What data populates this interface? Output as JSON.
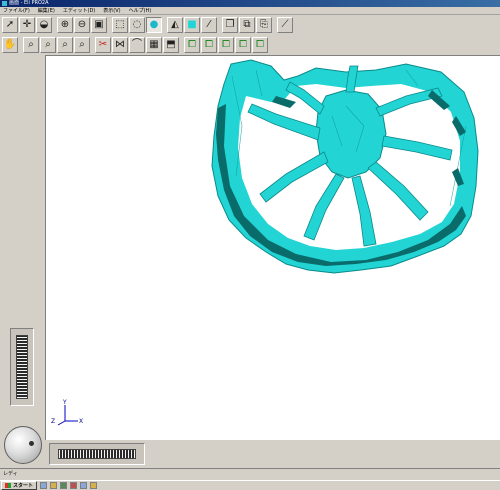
{
  "window": {
    "title": "画面 - Eli PRO2A"
  },
  "menu": {
    "items": [
      {
        "label": "ファイル(F)"
      },
      {
        "label": "編集(E)"
      },
      {
        "label": "エディット(D)"
      },
      {
        "label": "表示(V)"
      },
      {
        "label": "ヘルプ(H)"
      }
    ]
  },
  "toolbar1": {
    "buttons": [
      {
        "icon": "pointer-icon",
        "glyph": "➚"
      },
      {
        "icon": "crosshair-icon",
        "glyph": "✛"
      },
      {
        "icon": "bucket-icon",
        "glyph": "◒"
      },
      {
        "icon": "zoom-in-icon",
        "glyph": "⊕"
      },
      {
        "icon": "zoom-out-icon",
        "glyph": "⊖"
      },
      {
        "icon": "fit-view-icon",
        "glyph": "▣"
      },
      {
        "icon": "wireframe-cube-icon",
        "glyph": "⬚"
      },
      {
        "icon": "hidden-line-icon",
        "glyph": "◌"
      },
      {
        "icon": "shaded-sphere-icon",
        "glyph": "●"
      },
      {
        "icon": "fill-icon",
        "glyph": "◭"
      },
      {
        "icon": "color-swatch-icon",
        "glyph": "■"
      },
      {
        "icon": "line-tool-icon",
        "glyph": "⁄"
      },
      {
        "icon": "cube-view-icon",
        "glyph": "❐"
      },
      {
        "icon": "layers-icon",
        "glyph": "⧉"
      },
      {
        "icon": "copy-icon",
        "glyph": "⎘"
      },
      {
        "icon": "ruler-icon",
        "glyph": "⟋"
      }
    ]
  },
  "toolbar2": {
    "buttons": [
      {
        "icon": "hand-icon",
        "glyph": "✋"
      },
      {
        "icon": "zoom-box-icon",
        "glyph": "⌕"
      },
      {
        "icon": "zoom-window-icon",
        "glyph": "⌕"
      },
      {
        "icon": "zoom-previous-icon",
        "glyph": "⌕"
      },
      {
        "icon": "zoom-all-icon",
        "glyph": "⌕"
      },
      {
        "icon": "cut-icon",
        "glyph": "✂"
      },
      {
        "icon": "mirror-icon",
        "glyph": "⋈"
      },
      {
        "icon": "arc-icon",
        "glyph": "⌒"
      },
      {
        "icon": "grid-icon",
        "glyph": "▦"
      },
      {
        "icon": "frame-icon",
        "glyph": "⬒"
      },
      {
        "icon": "view-front-icon",
        "glyph": "⧠"
      },
      {
        "icon": "view-top-icon",
        "glyph": "⧠"
      },
      {
        "icon": "view-side-icon",
        "glyph": "⧠"
      },
      {
        "icon": "view-iso-icon",
        "glyph": "⧠"
      },
      {
        "icon": "view-back-icon",
        "glyph": "⧠"
      }
    ]
  },
  "viewport": {
    "axis_labels": {
      "x": "X",
      "y": "Y",
      "z": "Z"
    },
    "model_color": "#22d4d4",
    "model_shadow_color": "#0a6b6b"
  },
  "status": {
    "text": "レディ"
  },
  "taskbar": {
    "start_label": "スタート"
  },
  "colors": {
    "window_bg": "#d4d0c8",
    "viewport_bg": "#ffffff",
    "titlebar": "#0a246a"
  }
}
